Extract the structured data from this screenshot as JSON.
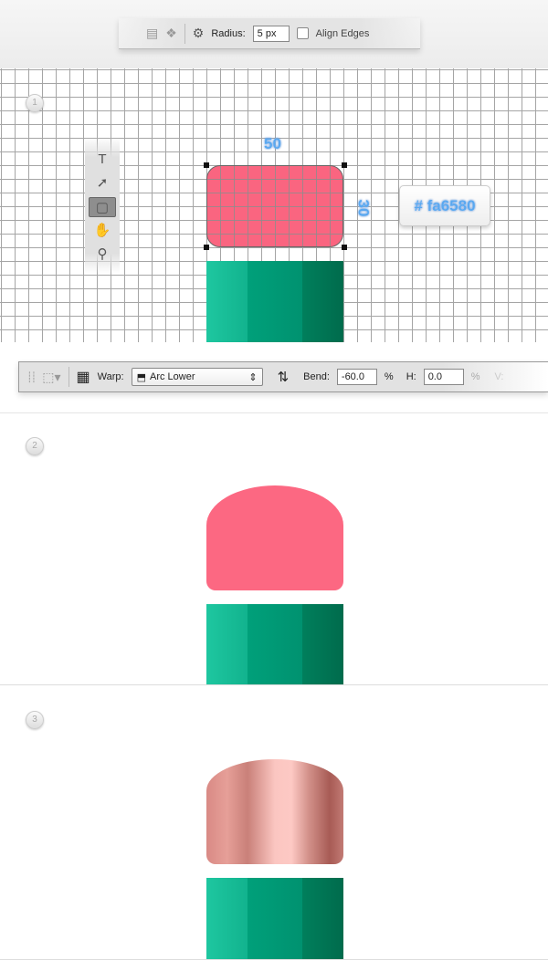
{
  "options_bar": {
    "radius_label": "Radius:",
    "radius_value": "5 px",
    "align_edges_label": "Align Edges",
    "align_edges_checked": false
  },
  "steps": [
    "1",
    "2",
    "3"
  ],
  "tools": [
    {
      "icon": "type-tool",
      "glyph": "T"
    },
    {
      "icon": "path-selection-tool",
      "glyph": "➚"
    },
    {
      "icon": "rounded-rectangle-tool",
      "glyph": "▢"
    },
    {
      "icon": "hand-tool",
      "glyph": "✋"
    },
    {
      "icon": "zoom-tool",
      "glyph": "⚲"
    }
  ],
  "annotations": {
    "width": "50",
    "height": "30",
    "color": "# fa6580"
  },
  "warp_bar": {
    "warp_label": "Warp:",
    "warp_style": "Arc Lower",
    "bend_label": "Bend:",
    "bend_value": "-60.0",
    "percent": "%",
    "h_label": "H:",
    "h_value": "0.0",
    "h_percent": "%",
    "v_label": "V:"
  },
  "colors": {
    "pink": "#fa6580",
    "green_light": "#1ec7a0",
    "green_mid": "#00a07a",
    "green_dark": "#007f5c"
  }
}
